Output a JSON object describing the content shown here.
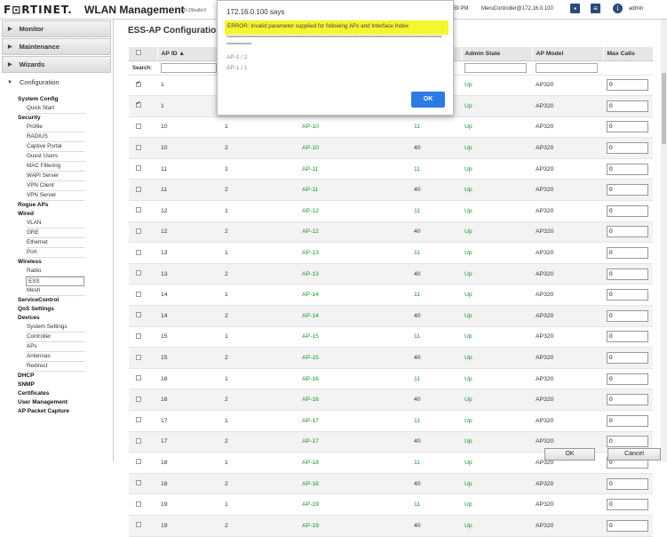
{
  "header": {
    "logo_text": "F⊡RTINET.",
    "title": "WLAN Management",
    "version": "7.0-15build-0",
    "clock": "59 PM",
    "controller_user": "MeruController@172.16.0.100",
    "user": "admin"
  },
  "sidebar": {
    "monitor": "Monitor",
    "maintenance": "Maintenance",
    "wizards": "Wizards",
    "configuration": "Configuration",
    "nav": [
      {
        "type": "sec",
        "label": "System Config"
      },
      {
        "type": "item",
        "label": "Quick Start"
      },
      {
        "type": "sec",
        "label": "Security"
      },
      {
        "type": "item",
        "label": "Profile"
      },
      {
        "type": "item",
        "label": "RADIUS"
      },
      {
        "type": "item",
        "label": "Captive Portal"
      },
      {
        "type": "item",
        "label": "Guest Users"
      },
      {
        "type": "item",
        "label": "MAC Filtering"
      },
      {
        "type": "item",
        "label": "WAPI Server"
      },
      {
        "type": "item",
        "label": "VPN Client"
      },
      {
        "type": "item",
        "label": "VPN Server"
      },
      {
        "type": "sec",
        "label": "Rogue APs"
      },
      {
        "type": "sec",
        "label": "Wired"
      },
      {
        "type": "item",
        "label": "VLAN"
      },
      {
        "type": "item",
        "label": "GRE"
      },
      {
        "type": "item",
        "label": "Ethernet"
      },
      {
        "type": "item",
        "label": "Port"
      },
      {
        "type": "sec",
        "label": "Wireless"
      },
      {
        "type": "item",
        "label": "Radio"
      },
      {
        "type": "item",
        "label": "ESS",
        "active": true
      },
      {
        "type": "item",
        "label": "Mesh"
      },
      {
        "type": "sec",
        "label": "ServiceControl"
      },
      {
        "type": "sec",
        "label": "QoS Settings"
      },
      {
        "type": "sec",
        "label": "Devices"
      },
      {
        "type": "item",
        "label": "System Settings"
      },
      {
        "type": "item",
        "label": "Controller"
      },
      {
        "type": "item",
        "label": "APs"
      },
      {
        "type": "item",
        "label": "Antennas"
      },
      {
        "type": "item",
        "label": "Redirect"
      },
      {
        "type": "sec",
        "label": "DHCP"
      },
      {
        "type": "sec",
        "label": "SNMP"
      },
      {
        "type": "sec",
        "label": "Certificates"
      },
      {
        "type": "sec",
        "label": "User Management"
      },
      {
        "type": "sec",
        "label": "AP Packet Capture"
      }
    ]
  },
  "main": {
    "title": "ESS-AP Configuration",
    "search_label": "Search:",
    "columns": [
      "",
      "AP ID ▲",
      "",
      "",
      "",
      "Admin State",
      "AP Model",
      "Max Calls"
    ],
    "rows": [
      {
        "checked": true,
        "ap_id": "1",
        "iface": "",
        "ap_name": "",
        "channel": "",
        "state": "Up",
        "model": "AP320",
        "max_calls": "0"
      },
      {
        "checked": true,
        "ap_id": "1",
        "iface": "",
        "ap_name": "",
        "channel": "",
        "state": "Up",
        "model": "AP320",
        "max_calls": "0"
      },
      {
        "checked": false,
        "ap_id": "10",
        "iface": "1",
        "ap_name": "AP-10",
        "channel": "11",
        "state": "Up",
        "model": "AP320",
        "max_calls": "0"
      },
      {
        "checked": false,
        "ap_id": "10",
        "iface": "2",
        "ap_name": "AP-10",
        "channel": "40",
        "state": "Up",
        "model": "AP320",
        "max_calls": "0"
      },
      {
        "checked": false,
        "ap_id": "11",
        "iface": "1",
        "ap_name": "AP-11",
        "channel": "11",
        "state": "Up",
        "model": "AP320",
        "max_calls": "0"
      },
      {
        "checked": false,
        "ap_id": "11",
        "iface": "2",
        "ap_name": "AP-11",
        "channel": "40",
        "state": "Up",
        "model": "AP320",
        "max_calls": "0"
      },
      {
        "checked": false,
        "ap_id": "12",
        "iface": "1",
        "ap_name": "AP-12",
        "channel": "11",
        "state": "Up",
        "model": "AP320",
        "max_calls": "0"
      },
      {
        "checked": false,
        "ap_id": "12",
        "iface": "2",
        "ap_name": "AP-12",
        "channel": "40",
        "state": "Up",
        "model": "AP320",
        "max_calls": "0"
      },
      {
        "checked": false,
        "ap_id": "13",
        "iface": "1",
        "ap_name": "AP-13",
        "channel": "11",
        "state": "Up",
        "model": "AP320",
        "max_calls": "0"
      },
      {
        "checked": false,
        "ap_id": "13",
        "iface": "2",
        "ap_name": "AP-13",
        "channel": "40",
        "state": "Up",
        "model": "AP320",
        "max_calls": "0"
      },
      {
        "checked": false,
        "ap_id": "14",
        "iface": "1",
        "ap_name": "AP-14",
        "channel": "11",
        "state": "Up",
        "model": "AP320",
        "max_calls": "0"
      },
      {
        "checked": false,
        "ap_id": "14",
        "iface": "2",
        "ap_name": "AP-14",
        "channel": "40",
        "state": "Up",
        "model": "AP320",
        "max_calls": "0"
      },
      {
        "checked": false,
        "ap_id": "15",
        "iface": "1",
        "ap_name": "AP-15",
        "channel": "11",
        "state": "Up",
        "model": "AP320",
        "max_calls": "0"
      },
      {
        "checked": false,
        "ap_id": "15",
        "iface": "2",
        "ap_name": "AP-15",
        "channel": "40",
        "state": "Up",
        "model": "AP320",
        "max_calls": "0"
      },
      {
        "checked": false,
        "ap_id": "16",
        "iface": "1",
        "ap_name": "AP-16",
        "channel": "11",
        "state": "Up",
        "model": "AP320",
        "max_calls": "0"
      },
      {
        "checked": false,
        "ap_id": "16",
        "iface": "2",
        "ap_name": "AP-16",
        "channel": "40",
        "state": "Up",
        "model": "AP320",
        "max_calls": "0"
      },
      {
        "checked": false,
        "ap_id": "17",
        "iface": "1",
        "ap_name": "AP-17",
        "channel": "11",
        "state": "Up",
        "model": "AP320",
        "max_calls": "0"
      },
      {
        "checked": false,
        "ap_id": "17",
        "iface": "2",
        "ap_name": "AP-17",
        "channel": "40",
        "state": "Up",
        "model": "AP320",
        "max_calls": "0"
      },
      {
        "checked": false,
        "ap_id": "18",
        "iface": "1",
        "ap_name": "AP-18",
        "channel": "11",
        "state": "Up",
        "model": "AP320",
        "max_calls": "0"
      },
      {
        "checked": false,
        "ap_id": "18",
        "iface": "2",
        "ap_name": "AP-18",
        "channel": "40",
        "state": "Up",
        "model": "AP320",
        "max_calls": "0"
      },
      {
        "checked": false,
        "ap_id": "19",
        "iface": "1",
        "ap_name": "AP-19",
        "channel": "11",
        "state": "Up",
        "model": "AP320",
        "max_calls": "0"
      },
      {
        "checked": false,
        "ap_id": "19",
        "iface": "2",
        "ap_name": "AP-19",
        "channel": "40",
        "state": "Up",
        "model": "AP320",
        "max_calls": "0"
      }
    ],
    "ok_label": "OK",
    "cancel_label": "Cancel"
  },
  "dialog": {
    "title": "172.16.0.100 says",
    "message": "ERROR: Invalid parameter supplied for following APs and Interface Index",
    "dashes": "==============================================================================",
    "dashes2": "=========",
    "aps": [
      "AP-1 / 2",
      "AP-1 / 1"
    ],
    "ok_label": "OK"
  },
  "colors": {
    "brand_red": "#d0202a",
    "state_green": "#1b8f2a",
    "dialog_highlight": "#f5f530",
    "dialog_ok": "#2c7be5"
  }
}
